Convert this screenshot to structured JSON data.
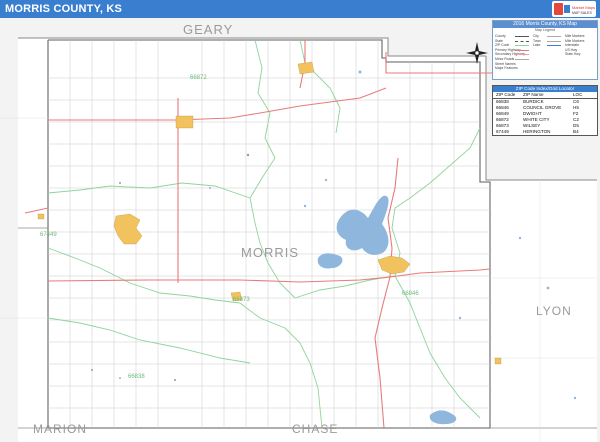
{
  "title": "MORRIS COUNTY, KS",
  "logo": {
    "line1": "Market Maps",
    "line2": "MAP SALES"
  },
  "map": {
    "counties": {
      "main": "MORRIS",
      "north": "GEARY",
      "east": "LYON",
      "southwest": "MARION",
      "south": "CHASE"
    },
    "zip_labels": [
      {
        "code": "66872"
      },
      {
        "code": "67449"
      },
      {
        "code": "66873"
      },
      {
        "code": "66846"
      },
      {
        "code": "66838"
      }
    ],
    "colors": {
      "county_fill": "#ffffff",
      "outside_fill": "#f3f3f3",
      "border": "#8a8a8a",
      "zip_boundary": "#8fd49a",
      "highway": "#e87b7b",
      "lake": "#8fb6dc",
      "town": "#f2c25e",
      "title_bar": "#3a7fcf"
    }
  },
  "legend": {
    "title": "2016 Morris County, KS Map",
    "subtitle": "Map Legend",
    "rows": [
      {
        "a": "County",
        "b": "City",
        "c": "Mile Markers"
      },
      {
        "a": "State",
        "b": "Town",
        "c": "Mile Markers"
      },
      {
        "a": "ZIP Code",
        "b": "Lake",
        "c": "Interstate"
      },
      {
        "a": "Primary Highway",
        "b": "",
        "c": "US Hwy"
      },
      {
        "a": "Secondary Highway",
        "b": "",
        "c": "State Hwy"
      },
      {
        "a": "Minor Roads",
        "b": "",
        "c": ""
      },
      {
        "a": "Street Names",
        "b": "",
        "c": ""
      },
      {
        "a": "Major Features",
        "b": "",
        "c": ""
      }
    ]
  },
  "zip_table": {
    "title": "ZIP Code Index/Grid Locator",
    "headers": [
      "ZIP Code",
      "ZIP Name",
      "LOC"
    ],
    "rows": [
      [
        "66838",
        "BURDICK",
        "C6"
      ],
      [
        "66846",
        "COUNCIL GROVE",
        "H5"
      ],
      [
        "66849",
        "DWIGHT",
        "F2"
      ],
      [
        "66872",
        "WHITE CITY",
        "C2"
      ],
      [
        "66873",
        "WILSEY",
        "D5"
      ],
      [
        "67449",
        "HERINGTON",
        "B4"
      ]
    ]
  }
}
